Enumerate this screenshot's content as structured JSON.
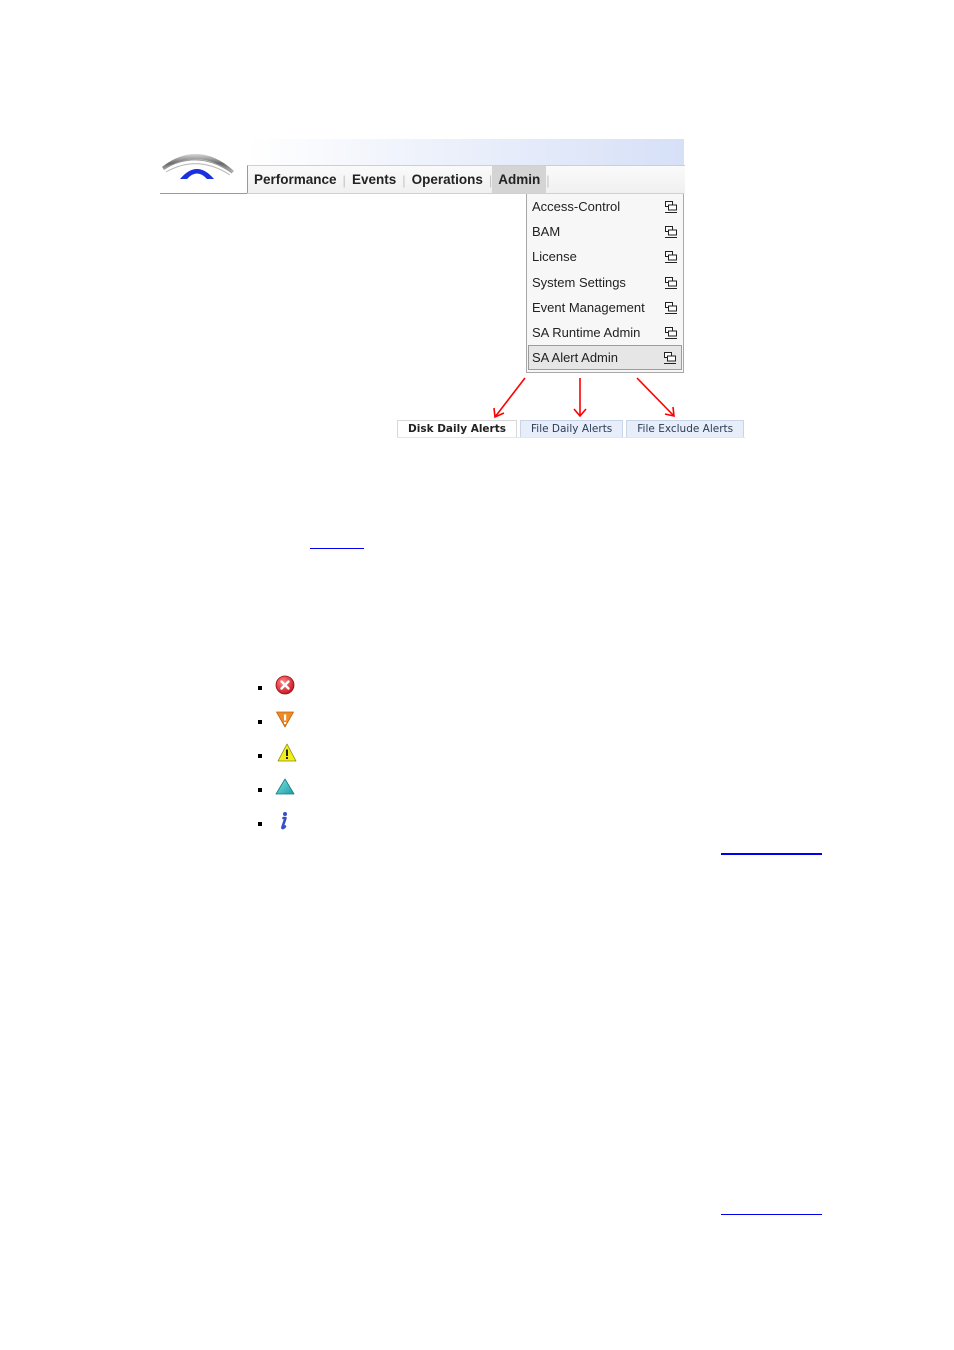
{
  "nav": {
    "items": [
      {
        "label": "Performance",
        "active": false
      },
      {
        "label": "Events",
        "active": false
      },
      {
        "label": "Operations",
        "active": false
      },
      {
        "label": "Admin",
        "active": true
      }
    ],
    "separator": "|"
  },
  "logo": {
    "icon": "arc-logo-icon"
  },
  "admin_menu": {
    "items": [
      {
        "label": "Access-Control",
        "icon": "open-window-icon",
        "selected": false
      },
      {
        "label": "BAM",
        "icon": "open-window-icon",
        "selected": false
      },
      {
        "label": "License",
        "icon": "open-window-icon",
        "selected": false
      },
      {
        "label": "System Settings",
        "icon": "open-window-icon",
        "selected": false
      },
      {
        "label": "Event Management",
        "icon": "open-window-icon",
        "selected": false
      },
      {
        "label": "SA Runtime Admin",
        "icon": "open-window-icon",
        "selected": false
      },
      {
        "label": "SA Alert Admin",
        "icon": "open-window-icon",
        "selected": true
      }
    ]
  },
  "annotation": {
    "arrow_color": "#ff0000"
  },
  "alert_tabs": [
    {
      "label": "Disk Daily Alerts",
      "active": true
    },
    {
      "label": "File Daily Alerts",
      "active": false
    },
    {
      "label": "File Exclude Alerts",
      "active": false
    }
  ],
  "links": {
    "color": "#0000ee"
  },
  "severity_icons": [
    {
      "icon": "critical-icon",
      "color": "#e0202a"
    },
    {
      "icon": "major-icon",
      "color": "#f08a24"
    },
    {
      "icon": "minor-warning-icon",
      "color": "#f2ee1c"
    },
    {
      "icon": "warning-icon",
      "color": "#35c3c6"
    },
    {
      "icon": "info-icon",
      "color": "#3550c8"
    }
  ]
}
